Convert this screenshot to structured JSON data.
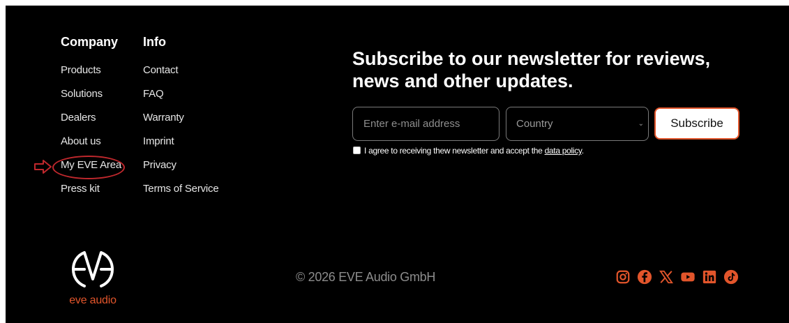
{
  "footer": {
    "company": {
      "heading": "Company",
      "links": [
        "Products",
        "Solutions",
        "Dealers",
        "About us",
        "My EVE Area",
        "Press kit"
      ]
    },
    "info": {
      "heading": "Info",
      "links": [
        "Contact",
        "FAQ",
        "Warranty",
        "Imprint",
        "Privacy",
        "Terms of Service"
      ]
    },
    "newsletter": {
      "title": "Subscribe to our newsletter for reviews, news and other updates.",
      "email_placeholder": "Enter e-mail address",
      "email_value": "",
      "country_selected": "Country",
      "subscribe_label": "Subscribe",
      "consent_text": "I agree to receiving thew newsletter and accept the ",
      "consent_link": "data policy",
      "consent_end": "."
    },
    "logo": {
      "text": "eve audio"
    },
    "copyright": "© 2026 EVE Audio GmbH",
    "socials": [
      "instagram-icon",
      "facebook-icon",
      "x-icon",
      "youtube-icon",
      "linkedin-icon",
      "tiktok-icon"
    ],
    "colors": {
      "background": "#000000",
      "accent": "#e2552b",
      "annotation": "#c0282d"
    }
  }
}
